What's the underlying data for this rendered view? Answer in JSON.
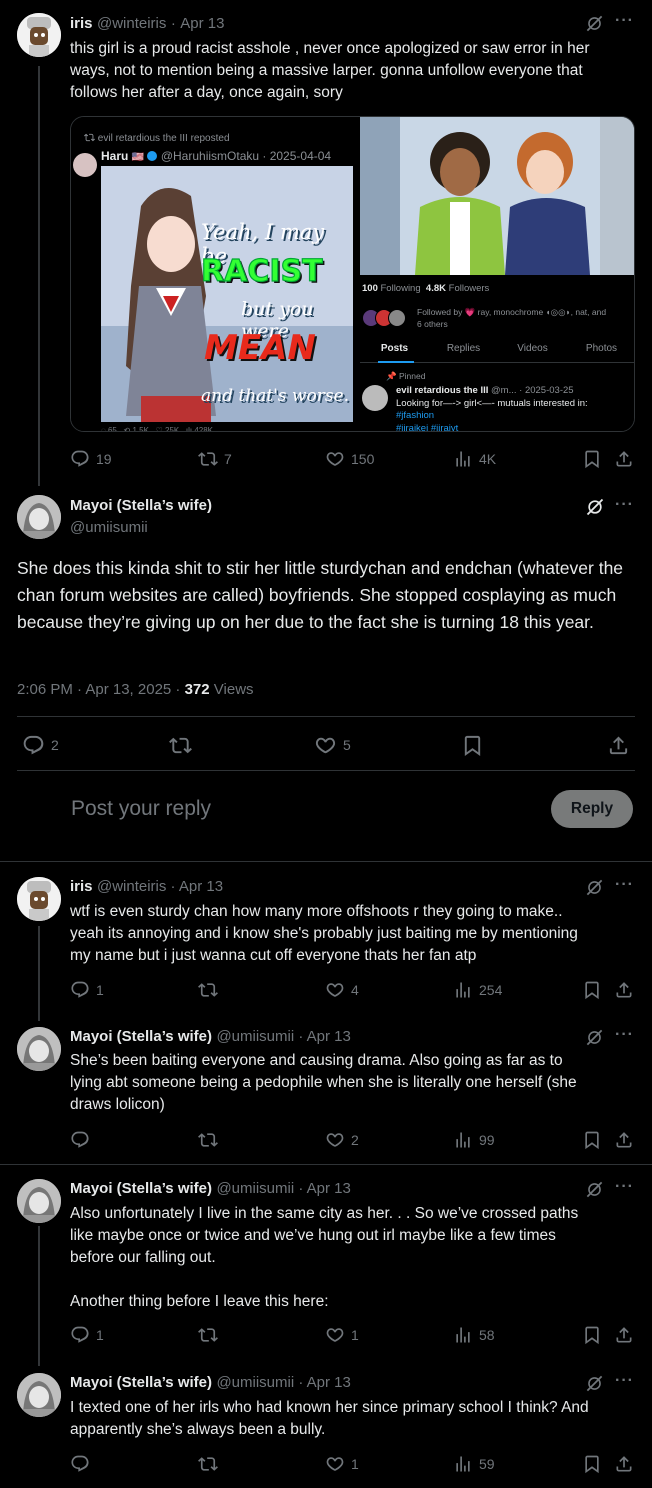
{
  "tweet1": {
    "name": "iris",
    "handle": "@winteiris",
    "date": "Apr 13",
    "text_l1": "this girl is a proud racist asshole , never once apologized or saw error in her",
    "text_l2": "ways, not to mention being a massive larper. gonna unfollow everyone that",
    "text_l3": "follows her after a day, once again,  sory",
    "replies": "19",
    "retweets": "7",
    "likes": "150",
    "views": "4K"
  },
  "media_left": {
    "repost_line": "evil retardious the III reposted",
    "author": "Haru",
    "author_meta": "@HaruhiismOtaku · 2025-04-04",
    "meme_l1": "Yeah, I may be",
    "meme_l2": "RACIST",
    "meme_l3": "but you were",
    "meme_l4": "MEAN",
    "meme_l5": "and that's worse."
  },
  "media_right": {
    "following_count": "100",
    "following_label": "Following",
    "followers_count": "4.8K",
    "followers_label": "Followers",
    "followed_by": "Followed by 💗 ray, monochrome ◖◎◎◗, nat, and",
    "followed_by_2": "6 others",
    "tabs": [
      "Posts",
      "Replies",
      "Videos",
      "Photos"
    ],
    "pinned": "Pinned",
    "pinned_author": "evil retardious the III",
    "pinned_meta": "@m... · 2025-03-25",
    "pinned_text": "Looking for—-> girl<—- mutuals interested in:",
    "pinned_tag1": "#jfashion",
    "pinned_tag2": "#jiraikei #jiraiyt"
  },
  "main": {
    "name": "Mayoi (Stella’s wife)",
    "handle": "@umiisumii",
    "text": "She does this kinda shit to stir her little sturdychan and endchan (whatever the chan forum websites are called) boyfriends. She stopped cosplaying as much because they’re giving up on her due to the fact she is turning 18 this year.",
    "timestamp": "2:06 PM · Apr 13, 2025 · ",
    "views_count": "372",
    "views_label": " Views",
    "replies": "2",
    "likes": "5"
  },
  "reply_box": {
    "placeholder": "Post your reply",
    "button": "Reply"
  },
  "reply1": {
    "name": "iris",
    "handle": "@winteiris · Apr 13",
    "l1": "wtf is even sturdy chan how many more offshoots r they going to make..",
    "l2": "yeah its annoying and i know she's probably just baiting  me by mentioning",
    "l3": "my name but i just wanna cut off everyone thats her fan atp",
    "replies": "1",
    "likes": "4",
    "views": "254"
  },
  "reply2": {
    "name": "Mayoi (Stella’s wife)",
    "handle": "@umiisumii · Apr 13",
    "l1": "She’s been baiting everyone and causing drama. Also going as far as to",
    "l2": "lying abt someone being a pedophile when she is literally one herself (she",
    "l3": "draws lolicon)",
    "likes": "2",
    "views": "99"
  },
  "reply3": {
    "name": "Mayoi (Stella’s wife)",
    "handle": "@umiisumii · Apr 13",
    "l1": "Also unfortunately I live in the same city as her. . . So we’ve crossed paths",
    "l2": "like maybe once or twice and we’ve hung out irl maybe like a few times",
    "l3": "before our falling out.",
    "l4": "Another thing before I leave this here:",
    "replies": "1",
    "likes": "1",
    "views": "58"
  },
  "reply4": {
    "name": "Mayoi (Stella’s wife)",
    "handle": "@umiisumii · Apr 13",
    "l1": "I texted one of her irls who had known her since primary school I think? And",
    "l2": "apparently she’s always been a bully.",
    "likes": "1",
    "views": "59"
  },
  "colors": {
    "background": "#000000",
    "text": "#e7e9ea",
    "muted": "#71767b",
    "divider": "#2f3336",
    "verified": "#1d9bf0",
    "reply_button": "#787a7a"
  },
  "icons": [
    "reply-icon",
    "retweet-icon",
    "like-icon",
    "views-icon",
    "bookmark-icon",
    "share-icon",
    "grok-icon",
    "more-icon"
  ]
}
